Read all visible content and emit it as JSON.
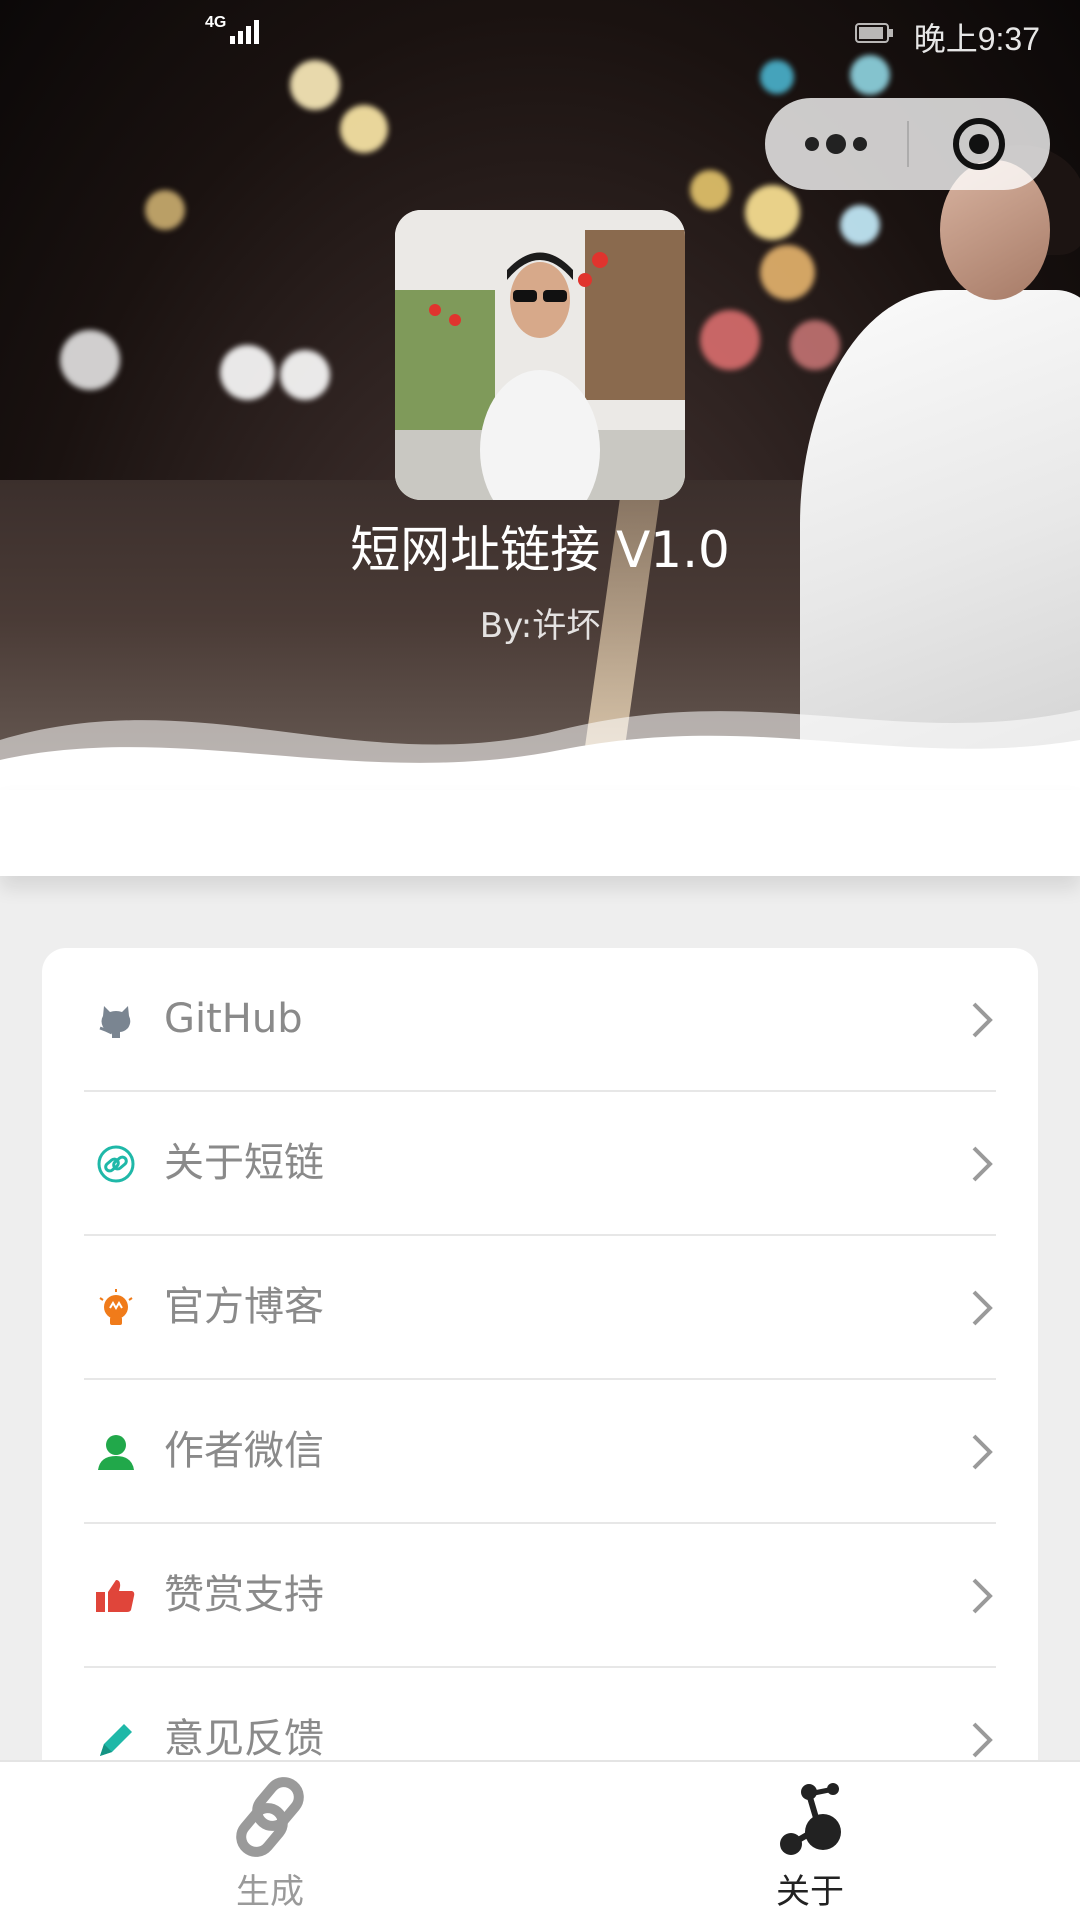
{
  "status_bar": {
    "network": "4G",
    "time": "晚上9:37"
  },
  "header": {
    "app_title": "短网址链接 V1.0",
    "author": "By:许坏"
  },
  "capsule": {
    "more_icon": "more-dots-icon",
    "close_icon": "target-icon"
  },
  "menu": {
    "items": [
      {
        "label": "GitHub",
        "icon": "github-icon",
        "icon_color": "#7a8591"
      },
      {
        "label": "关于短链",
        "icon": "link-icon",
        "icon_color": "#1fb8a8"
      },
      {
        "label": "官方博客",
        "icon": "lightbulb-icon",
        "icon_color": "#f07b1a"
      },
      {
        "label": "作者微信",
        "icon": "person-icon",
        "icon_color": "#21a84a"
      },
      {
        "label": "赞赏支持",
        "icon": "thumbs-up-icon",
        "icon_color": "#e0453a"
      },
      {
        "label": "意见反馈",
        "icon": "pencil-icon",
        "icon_color": "#1fb8a8"
      }
    ]
  },
  "tabbar": {
    "tabs": [
      {
        "label": "生成",
        "icon": "link-chain-icon",
        "active": false,
        "color": "#9a9a9a"
      },
      {
        "label": "关于",
        "icon": "molecule-icon",
        "active": true,
        "color": "#222222"
      }
    ]
  }
}
